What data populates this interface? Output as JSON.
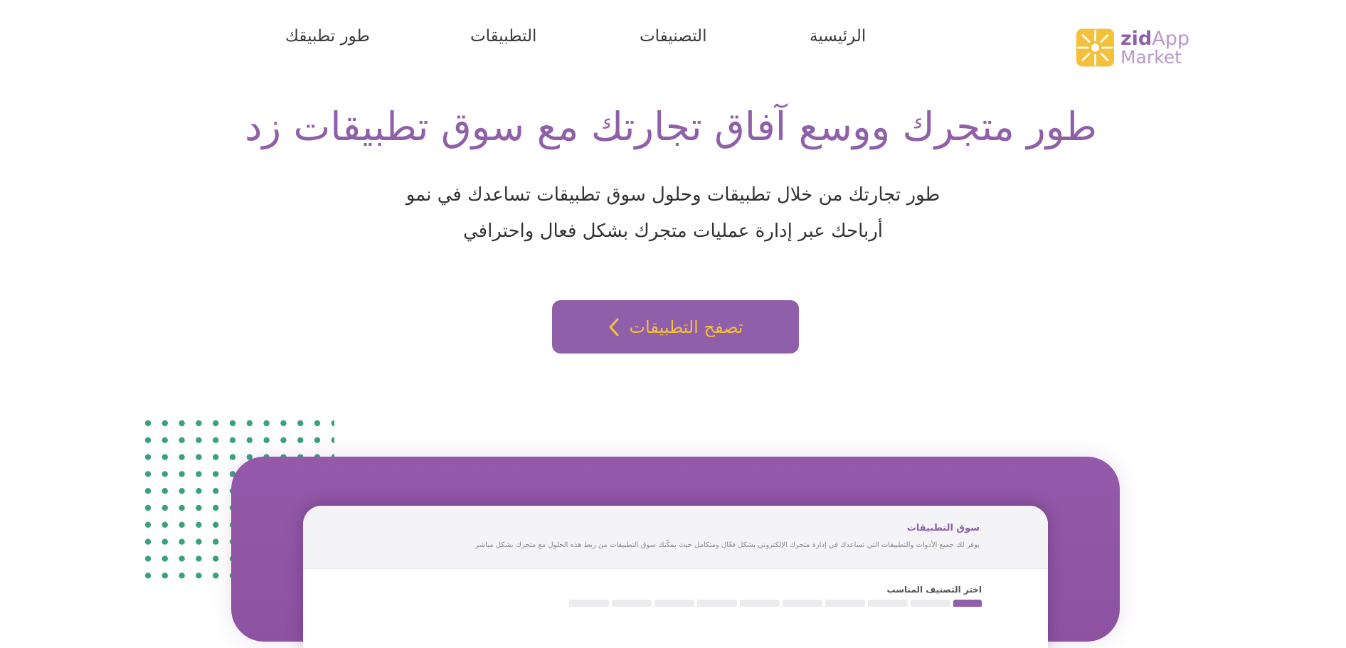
{
  "colors": {
    "brand_purple": "#8f5fa9",
    "accent_yellow": "#f5c13a",
    "dot_green": "#3aa17e",
    "nav_text": "#3b3b3b"
  },
  "header": {
    "logo": {
      "icon": "zid-flower-logo-icon",
      "brand": "zid",
      "word1": "App",
      "word2": "Market"
    },
    "nav": {
      "home": "الرئيسية",
      "categories": "التصنيفات",
      "apps": "التطبيقات",
      "develop": "طور تطبيقك"
    }
  },
  "hero": {
    "title": "طور متجرك ووسع آفاق تجارتك مع سوق تطبيقات زد",
    "subtitle_line1": "طور تجارتك من خلال تطبيقات وحلول سوق تطبيقات تساعدك في نمو",
    "subtitle_line2": "أرباحك عبر إدارة عمليات متجرك بشكل فعال واحترافي",
    "cta_label": "تصفح التطبيقات",
    "cta_icon": "chevron-left-icon"
  },
  "preview": {
    "title": "سوق التطبيقات",
    "description": "يوفر لك جميع الأدوات والتطبيقات التي تساعدك في إدارة متجرك الإلكتروني بشكل فعّال ومتكامل حيث يمكّنك سوق التطبيقات من ربط هذه الحلول مع متجرك بشكل مباشر",
    "filter_label": "اختر التصنيف المناسب"
  }
}
